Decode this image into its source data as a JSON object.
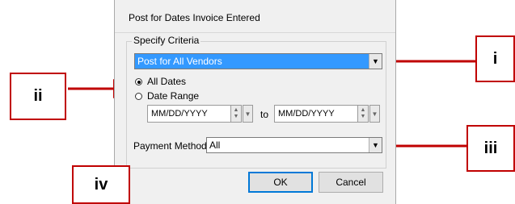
{
  "dialog": {
    "title": "Post for Dates Invoice Entered",
    "group_label": "Specify Criteria",
    "vendor_select": "Post for All Vendors",
    "radio_all_dates": "All Dates",
    "radio_date_range": "Date Range",
    "date_from_placeholder": "MM/DD/YYYY",
    "to_label": "to",
    "date_to_placeholder": "MM/DD/YYYY",
    "payment_method_label": "Payment Method:",
    "payment_method_value": "All",
    "ok_label": "OK",
    "cancel_label": "Cancel"
  },
  "callouts": {
    "i": "i",
    "ii": "ii",
    "iii": "iii",
    "iv": "iv"
  },
  "colors": {
    "arrow": "#c00000",
    "selection": "#3399ff"
  }
}
